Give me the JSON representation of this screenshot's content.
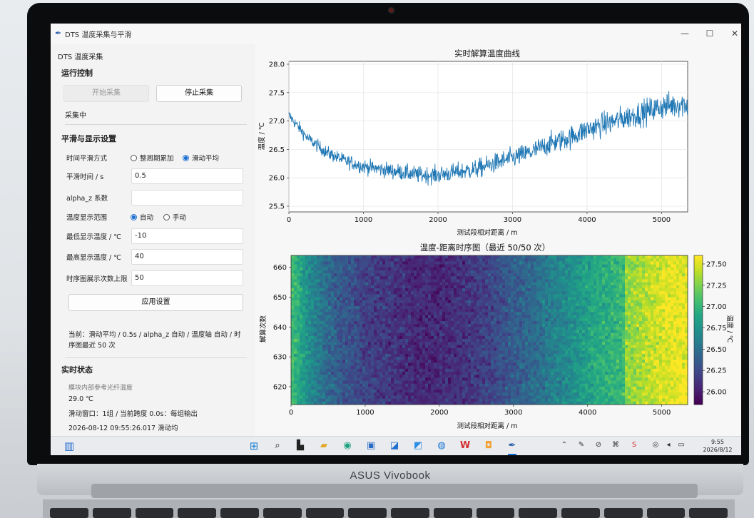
{
  "laptop": {
    "brand": "ASUS Vivobook"
  },
  "window": {
    "title": "DTS 温度采集与平滑",
    "controls": {
      "minimize": "—",
      "maximize": "☐",
      "close": "✕"
    }
  },
  "sidebar": {
    "app_heading": "DTS 温度采集",
    "run_control": {
      "title": "运行控制",
      "start_label": "开始采集",
      "stop_label": "停止采集",
      "status": "采集中"
    },
    "settings": {
      "title": "平滑与显示设置",
      "time_smoothing": {
        "label": "时间平滑方式",
        "options": [
          "整周期累加",
          "滑动平均"
        ],
        "selected": "滑动平均"
      },
      "smooth_time": {
        "label": "平滑时间 / s",
        "value": "0.5"
      },
      "alpha_z": {
        "label": "alpha_z 系数",
        "value": ""
      },
      "temp_range": {
        "label": "温度显示范围",
        "options": [
          "自动",
          "手动"
        ],
        "selected": "自动"
      },
      "min_temp": {
        "label": "最低显示温度 / ℃",
        "value": "-10"
      },
      "max_temp": {
        "label": "最高显示温度 / ℃",
        "value": "40"
      },
      "timeseries_limit": {
        "label": "时序图展示次数上限",
        "value": "50"
      },
      "apply_label": "应用设置",
      "current_summary": "当前：滑动平均 / 0.5s / alpha_z 自动 / 温度轴 自动 / 时序图最近 50 次"
    },
    "live_status": {
      "title": "实时状态",
      "ref_label": "模块内部参考光纤温度",
      "ref_value": "29.0 ℃",
      "window_info": "滑动窗口：1组 / 当前跨度 0.0s：每组输出",
      "timestamp_partial": "2026-08-12 09:55:26.017  滑动均"
    }
  },
  "chart_data": [
    {
      "type": "line",
      "title": "实时解算温度曲线",
      "xlabel": "测试段相对距离 / m",
      "ylabel": "温度 / ℃",
      "xlim": [
        0,
        5350
      ],
      "ylim": [
        25.4,
        28.05
      ],
      "x_ticks": [
        0,
        1000,
        2000,
        3000,
        4000,
        5000
      ],
      "y_ticks": [
        25.5,
        26.0,
        26.5,
        27.0,
        27.5,
        28.0
      ],
      "grid": true,
      "color": "#1f77b4",
      "series": [
        {
          "x": [
            0,
            250,
            500,
            750,
            1000,
            1250,
            1500,
            1750,
            2000,
            2250,
            2500,
            2750,
            3000,
            3250,
            3500,
            3750,
            4000,
            4250,
            4500,
            4750,
            5000,
            5250,
            5350
          ],
          "y": [
            27.1,
            26.7,
            26.45,
            26.3,
            26.2,
            26.15,
            26.1,
            26.05,
            26.05,
            26.1,
            26.15,
            26.25,
            26.35,
            26.45,
            26.6,
            26.7,
            26.85,
            26.95,
            27.05,
            27.15,
            27.25,
            27.3,
            27.3
          ],
          "noise": 0.32
        }
      ]
    },
    {
      "type": "heatmap",
      "title": "温度-距离时序图（最近 50/50 次）",
      "xlabel": "测试段相对距离 / m",
      "ylabel": "解算次数",
      "colorbar_label": "温度 / ℃",
      "xlim": [
        0,
        5350
      ],
      "ylim": [
        614,
        664
      ],
      "x_ticks": [
        0,
        1000,
        2000,
        3000,
        4000,
        5000
      ],
      "y_ticks": [
        620,
        630,
        640,
        650,
        660
      ],
      "colorbar_ticks": [
        26.0,
        26.25,
        26.5,
        26.75,
        27.0,
        27.25,
        27.5
      ],
      "vmin": 25.85,
      "vmax": 27.6,
      "colormap": "viridis"
    }
  ],
  "taskbar": {
    "clock_time": "9:55",
    "clock_date": "2026/8/12",
    "icons": [
      "start-icon",
      "search-icon",
      "task-view-icon",
      "file-explorer-icon",
      "edge-icon",
      "store-icon",
      "app-icon-1",
      "app-icon-2",
      "browser-icon",
      "wps-icon",
      "app-icon-3",
      "feather-app-icon"
    ]
  }
}
